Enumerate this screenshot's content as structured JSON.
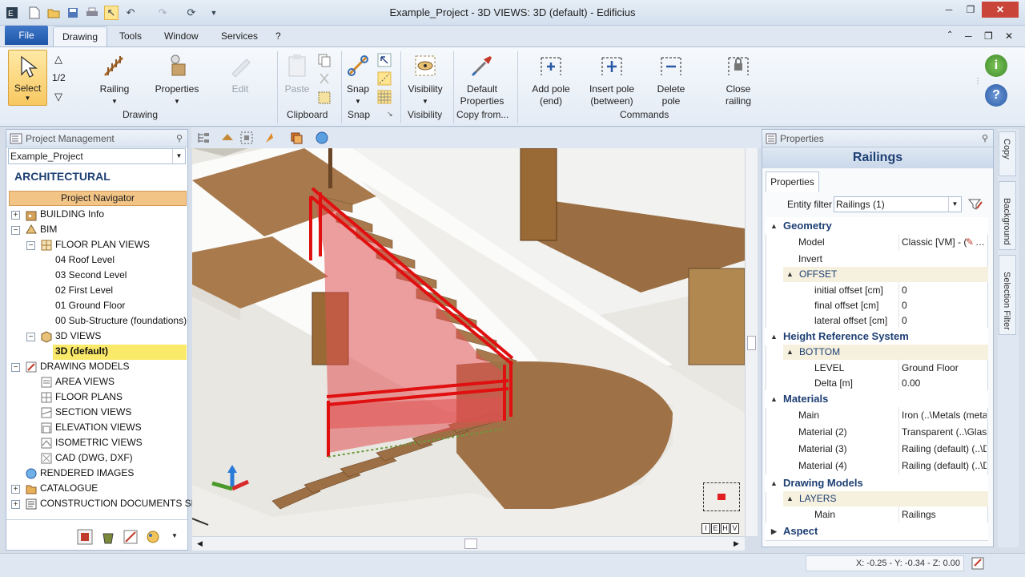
{
  "window": {
    "title": "Example_Project - 3D VIEWS: 3D (default) - Edificius"
  },
  "menus": {
    "file": "File",
    "drawing": "Drawing",
    "tools": "Tools",
    "window": "Window",
    "services": "Services",
    "help": "?"
  },
  "ribbon": {
    "select": "Select",
    "half": "1/2",
    "railing": "Railing",
    "properties": "Properties",
    "edit": "Edit",
    "paste": "Paste",
    "snap": "Snap",
    "visibility": "Visibility",
    "default_properties_1": "Default",
    "default_properties_2": "Properties",
    "add_pole_1": "Add pole",
    "add_pole_2": "(end)",
    "insert_pole_1": "Insert pole",
    "insert_pole_2": "(between)",
    "delete_pole_1": "Delete",
    "delete_pole_2": "pole",
    "close_railing_1": "Close",
    "close_railing_2": "railing",
    "groups": {
      "drawing": "Drawing",
      "clipboard": "Clipboard",
      "snap": "Snap",
      "visibility": "Visibility",
      "copy_from": "Copy from...",
      "commands": "Commands"
    }
  },
  "project": {
    "header": "Project Management",
    "project_select": "Example_Project",
    "section": "ARCHITECTURAL",
    "navigator": "Project Navigator",
    "tree": [
      "BUILDING Info",
      "BIM",
      "FLOOR PLAN VIEWS",
      "04 Roof Level",
      "03 Second Level",
      "02 First Level",
      "01 Ground Floor",
      "00 Sub-Structure (foundations)",
      "3D VIEWS",
      "3D (default)",
      "DRAWING MODELS",
      "AREA VIEWS",
      "FLOOR PLANS",
      "SECTION VIEWS",
      "ELEVATION VIEWS",
      "ISOMETRIC VIEWS",
      "CAD (DWG, DXF)",
      "RENDERED IMAGES",
      "CATALOGUE",
      "CONSTRUCTION DOCUMENTS SET"
    ]
  },
  "viewport": {
    "cube_labels": [
      "I",
      "E",
      "H",
      "V"
    ]
  },
  "properties": {
    "header": "Properties",
    "title": "Railings",
    "tab": "Properties",
    "entity_filter_label": "Entity filter",
    "entity_filter_value": "Railings (1)",
    "geometry": "Geometry",
    "model_label": "Model",
    "model_value": "Classic [VM] - (",
    "invert_label": "Invert",
    "offset": "OFFSET",
    "initial_offset_label": "initial offset  [cm]",
    "initial_offset_value": "0",
    "final_offset_label": "final offset  [cm]",
    "final_offset_value": "0",
    "lateral_offset_label": "lateral offset  [cm]",
    "lateral_offset_value": "0",
    "height_ref": "Height Reference System",
    "bottom": "BOTTOM",
    "level_label": "LEVEL",
    "level_value": "Ground Floor",
    "delta_label": "Delta  [m]",
    "delta_value": "0.00",
    "materials": "Materials",
    "main_label": "Main",
    "main_value": "Iron  (..\\Metals (meta",
    "mat2_label": "Material (2)",
    "mat2_value": "Transparent  (..\\Glass",
    "mat3_label": "Material (3)",
    "mat3_value": "Railing (default)  (..\\D",
    "mat4_label": "Material (4)",
    "mat4_value": "Railing (default)  (..\\D",
    "drawing_models": "Drawing Models",
    "layers": "LAYERS",
    "layers_main_label": "Main",
    "layers_main_value": "Railings",
    "aspect": "Aspect"
  },
  "side_tabs": {
    "copy": "Copy",
    "background": "Background",
    "selection_filter": "Selection Filter"
  },
  "statusbar": {
    "coords": "X: -0.25 - Y: -0.34 - Z: 0.00"
  }
}
